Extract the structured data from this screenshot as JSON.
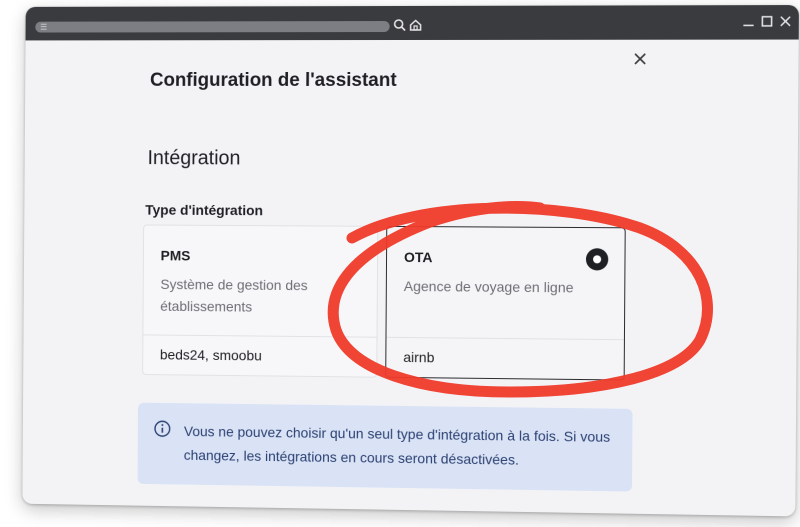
{
  "dialog": {
    "title": "Configuration de l'assistant",
    "section_title": "Intégration",
    "field_label": "Type d'intégration"
  },
  "options": [
    {
      "title": "PMS",
      "description": "Système de gestion des établissements",
      "providers": "beds24, smoobu",
      "selected": false
    },
    {
      "title": "OTA",
      "description": "Agence de voyage en ligne",
      "providers": "airnb",
      "selected": true
    }
  ],
  "info": {
    "icon": "info-icon",
    "text": "Vous ne pouvez choisir qu'un seul type d'intégration à la fois. Si vous changez, les intégrations en cours seront désactivées."
  },
  "icons": {
    "close": "close-icon",
    "search": "search-icon",
    "home": "home-icon",
    "minimize": "minimize-icon",
    "maximize": "maximize-icon",
    "window_close": "window-close-icon"
  },
  "colors": {
    "titlebar": "#3a3b3e",
    "background": "#f3f3f6",
    "info_bg": "#d9e3f5",
    "info_text": "#2b3f72",
    "annotation": "#ef3a2a"
  }
}
